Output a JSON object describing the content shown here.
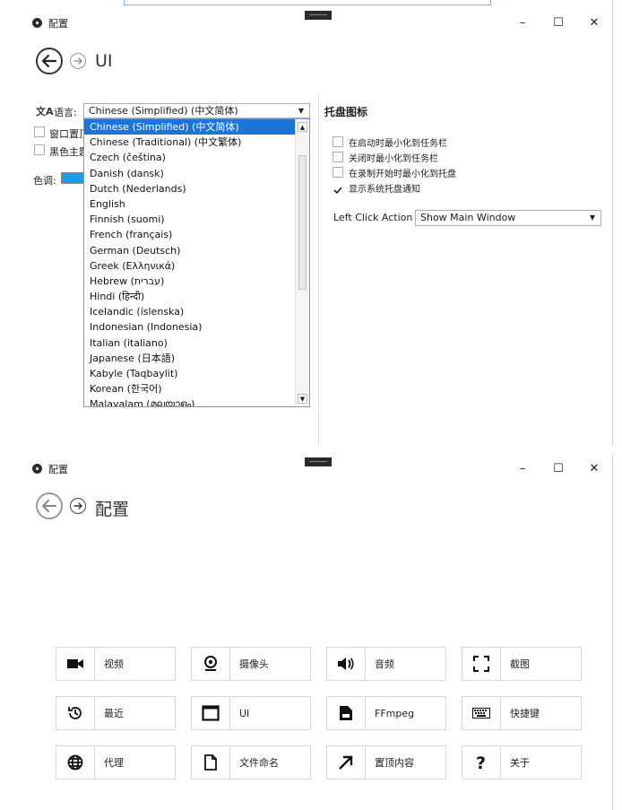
{
  "top": {
    "window_title": "配置",
    "page_title": "UI",
    "language_label": "语言:",
    "language_selected": "Chinese (Simplified) (中文简体)",
    "checkbox_topmost": "窗口置顶",
    "checkbox_dark": "黑色主题",
    "color_label": "色调:",
    "language_options": [
      "Chinese (Simplified) (中文简体)",
      "Chinese (Traditional) (中文繁体)",
      "Czech (čeština)",
      "Danish (dansk)",
      "Dutch (Nederlands)",
      "English",
      "Finnish (suomi)",
      "French (français)",
      "German (Deutsch)",
      "Greek (Ελληνικά)",
      "Hebrew (עברית)",
      "Hindi (हिन्दी)",
      "Icelandic (íslenska)",
      "Indonesian (Indonesia)",
      "Italian (italiano)",
      "Japanese (日本語)",
      "Kabyle (Taqbaylit)",
      "Korean (한국어)",
      "Malayalam (മലയാളം)"
    ],
    "tray_section_title": "托盘图标",
    "tray_options": [
      {
        "label": "在启动时最小化到任务栏",
        "checked": false
      },
      {
        "label": "关闭时最小化到任务栏",
        "checked": false
      },
      {
        "label": "在录制开始时最小化到托盘",
        "checked": false
      },
      {
        "label": "显示系统托盘通知",
        "checked": true
      }
    ],
    "left_click_label": "Left Click Action",
    "left_click_value": "Show Main Window",
    "accent_color": "#1e9be8"
  },
  "bottom": {
    "window_title": "配置",
    "page_title": "配置",
    "tiles": [
      {
        "label": "视频",
        "icon": "video-camera-icon"
      },
      {
        "label": "摄像头",
        "icon": "webcam-icon"
      },
      {
        "label": "音频",
        "icon": "speaker-icon"
      },
      {
        "label": "截图",
        "icon": "screenshot-icon"
      },
      {
        "label": "最近",
        "icon": "history-icon"
      },
      {
        "label": "UI",
        "icon": "window-icon"
      },
      {
        "label": "FFmpeg",
        "icon": "file-icon"
      },
      {
        "label": "快捷键",
        "icon": "keyboard-icon"
      },
      {
        "label": "代理",
        "icon": "globe-icon"
      },
      {
        "label": "文件命名",
        "icon": "document-icon"
      },
      {
        "label": "置顶内容",
        "icon": "arrow-icon"
      },
      {
        "label": "关于",
        "icon": "question-icon"
      }
    ]
  },
  "window_controls": {
    "minimize": "–",
    "maximize": "☐",
    "close": "✕"
  }
}
